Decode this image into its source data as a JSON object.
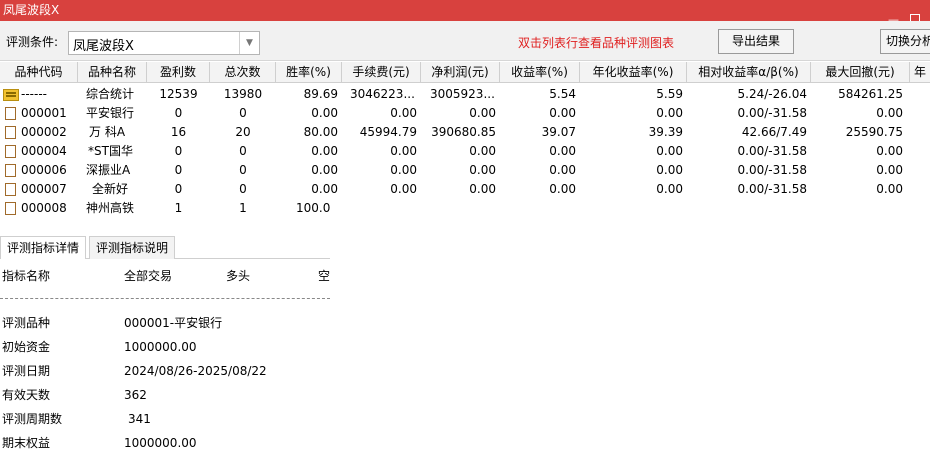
{
  "window": {
    "title": "凤尾波段X"
  },
  "toolbar": {
    "condition_label": "评测条件:",
    "condition_value": "凤尾波段X",
    "hint": "双击列表行查看品种评测图表",
    "export_label": "导出结果",
    "switch_label": "切换分析"
  },
  "grid": {
    "columns": [
      "品种代码",
      "品种名称",
      "盈利数",
      "总次数",
      "胜率(%)",
      "手续费(元)",
      "净利润(元)",
      "收益率(%)",
      "年化收益率(%)",
      "相对收益率α/β(%)",
      "最大回撤(元)",
      "年"
    ],
    "rows": [
      {
        "code": "------",
        "name": "综合统计",
        "wins": "12539",
        "total": "13980",
        "winrate": "89.69",
        "fee": "3046223...",
        "profit": "3005923...",
        "ret": "5.54",
        "annual": "5.59",
        "alpha": "5.24/-26.04",
        "drawdown": "584261.25"
      },
      {
        "code": "000001",
        "name": "平安银行",
        "wins": "0",
        "total": "0",
        "winrate": "0.00",
        "fee": "0.00",
        "profit": "0.00",
        "ret": "0.00",
        "annual": "0.00",
        "alpha": "0.00/-31.58",
        "drawdown": "0.00"
      },
      {
        "code": "000002",
        "name": "万 科A",
        "wins": "16",
        "total": "20",
        "winrate": "80.00",
        "fee": "45994.79",
        "profit": "390680.85",
        "ret": "39.07",
        "annual": "39.39",
        "alpha": "42.66/7.49",
        "drawdown": "25590.75"
      },
      {
        "code": "000004",
        "name": "*ST国华",
        "wins": "0",
        "total": "0",
        "winrate": "0.00",
        "fee": "0.00",
        "profit": "0.00",
        "ret": "0.00",
        "annual": "0.00",
        "alpha": "0.00/-31.58",
        "drawdown": "0.00"
      },
      {
        "code": "000006",
        "name": "深振业A",
        "wins": "0",
        "total": "0",
        "winrate": "0.00",
        "fee": "0.00",
        "profit": "0.00",
        "ret": "0.00",
        "annual": "0.00",
        "alpha": "0.00/-31.58",
        "drawdown": "0.00"
      },
      {
        "code": "000007",
        "name": "全新好",
        "wins": "0",
        "total": "0",
        "winrate": "0.00",
        "fee": "0.00",
        "profit": "0.00",
        "ret": "0.00",
        "annual": "0.00",
        "alpha": "0.00/-31.58",
        "drawdown": "0.00"
      },
      {
        "code": "000008",
        "name": "神州高铁",
        "wins": "1",
        "total": "1",
        "winrate": "100.0",
        "fee": "",
        "profit": "",
        "ret": "",
        "annual": "",
        "alpha": "",
        "drawdown": ""
      }
    ]
  },
  "detail": {
    "tabs": [
      "评测指标详情",
      "评测指标说明"
    ],
    "headers": [
      "指标名称",
      "全部交易",
      "多头",
      "空"
    ],
    "items": [
      {
        "label": "评测品种",
        "value": "000001-平安银行"
      },
      {
        "label": "初始资金",
        "value": "1000000.00"
      },
      {
        "label": "评测日期",
        "value": "2024/08/26-2025/08/22"
      },
      {
        "label": "有效天数",
        "value": "362"
      },
      {
        "label": "评测周期数",
        "value": "341"
      },
      {
        "label": "期末权益",
        "value": "1000000.00"
      }
    ]
  }
}
